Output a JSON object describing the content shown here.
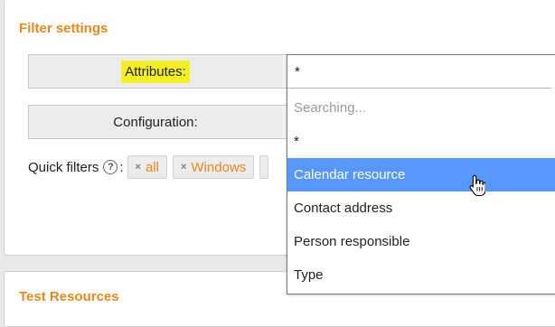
{
  "filter_settings": {
    "title": "Filter settings",
    "attributes_label": "Attributes:",
    "configuration_label": "Configuration:",
    "quick_filters_label": "Quick filters",
    "quick_filters_help": "?",
    "quick_filters_colon": ":",
    "chips": [
      {
        "label": "all"
      },
      {
        "label": "Windows"
      }
    ]
  },
  "dropdown": {
    "search_value": "*",
    "searching_text": "Searching...",
    "options": [
      {
        "label": "*"
      },
      {
        "label": "Calendar resource"
      },
      {
        "label": "Contact address"
      },
      {
        "label": "Person responsible"
      },
      {
        "label": "Type"
      }
    ],
    "highlighted_option": "Calendar resource"
  },
  "test_resources": {
    "title": "Test Resources"
  },
  "colors": {
    "accent_orange": "#e8891a",
    "highlight_yellow": "#f2f024",
    "option_highlight": "#5897fb"
  },
  "icons": {
    "chip_remove": "×",
    "help": "question-circle-icon",
    "pointer": "hand-pointer-icon"
  }
}
